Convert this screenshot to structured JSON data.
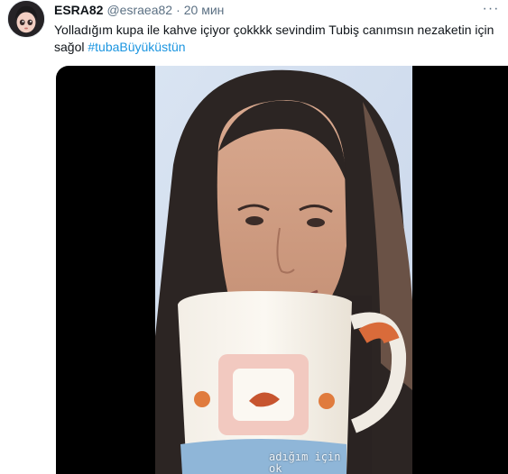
{
  "tweet": {
    "author_name": "ESRA82",
    "author_handle": "@esraea82",
    "separator": "·",
    "time": "20 мин",
    "more_label": "···",
    "text_main": "Yolladığım kupa ile kahve içiyor çokkkk sevindim Tubiş canımsın nezaketin için sağol ",
    "hashtag": "#tubaBüyüküstün"
  },
  "media": {
    "overlay_line1": "adığım için",
    "overlay_line2": "ok"
  },
  "icons": {
    "avatar": "user-avatar",
    "more": "more-options-icon"
  },
  "colors": {
    "text": "#0f1419",
    "secondary": "#5b7083",
    "link": "#1b95e0",
    "media_bg": "#000000"
  }
}
